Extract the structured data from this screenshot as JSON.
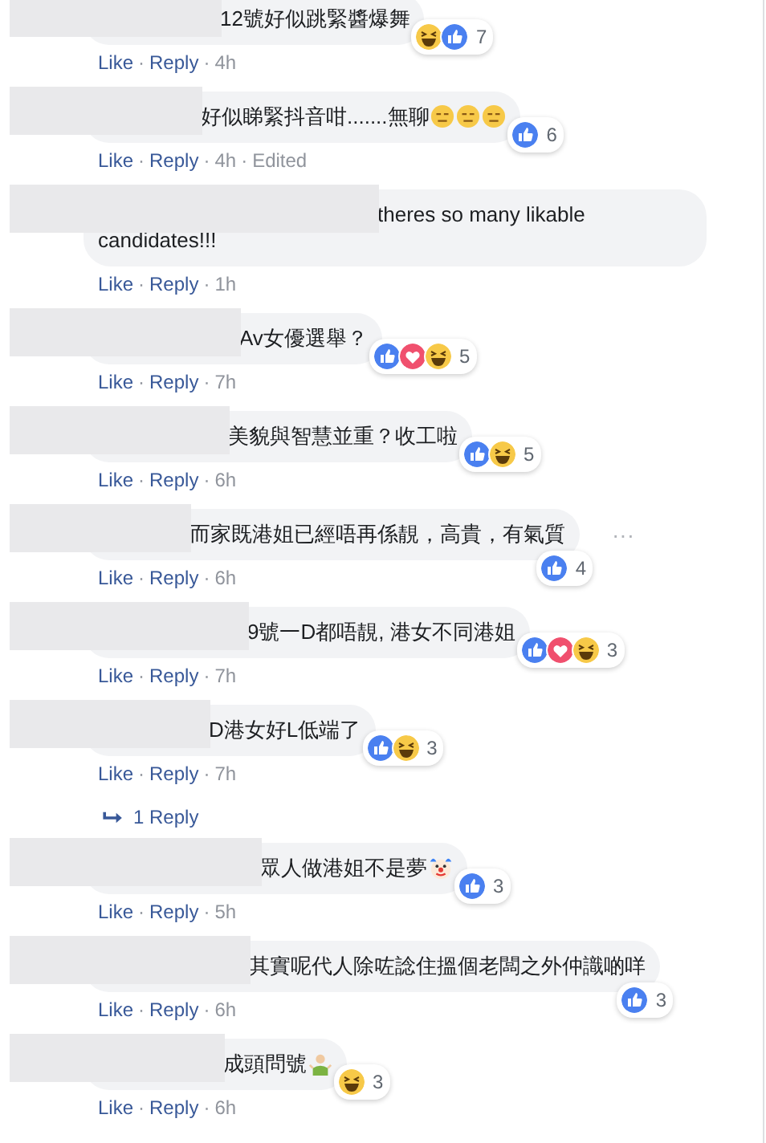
{
  "comments": [
    {
      "name_hidden": true,
      "text": "12號好似跳緊醬爆舞",
      "reactions": [
        {
          "kind": "haha"
        },
        {
          "kind": "like"
        }
      ],
      "reaction_count": "7",
      "meta": [
        {
          "kind": "link",
          "text": "Like"
        },
        {
          "kind": "dot",
          "text": "·"
        },
        {
          "kind": "link",
          "text": "Reply"
        },
        {
          "kind": "dot",
          "text": "·"
        },
        {
          "kind": "time",
          "text": "4h"
        }
      ]
    },
    {
      "name_hidden": true,
      "text": "好似睇緊抖音咁.......無聊",
      "emoji": [
        {
          "kind": "expressionless"
        },
        {
          "kind": "expressionless"
        },
        {
          "kind": "expressionless"
        }
      ],
      "reactions": [
        {
          "kind": "like"
        }
      ],
      "reaction_count": "6",
      "meta": [
        {
          "kind": "link",
          "text": "Like"
        },
        {
          "kind": "dot",
          "text": "·"
        },
        {
          "kind": "link",
          "text": "Reply"
        },
        {
          "kind": "dot",
          "text": "·"
        },
        {
          "kind": "time",
          "text": "4h"
        },
        {
          "kind": "dot",
          "text": "·"
        },
        {
          "kind": "note",
          "text": "Edited"
        }
      ]
    },
    {
      "name_hidden": true,
      "text": "theres so many likable candidates!!!",
      "meta": [
        {
          "kind": "link",
          "text": "Like"
        },
        {
          "kind": "dot",
          "text": "·"
        },
        {
          "kind": "link",
          "text": "Reply"
        },
        {
          "kind": "dot",
          "text": "·"
        },
        {
          "kind": "time",
          "text": "1h"
        }
      ]
    },
    {
      "name_hidden": true,
      "text": "Av女優選舉？",
      "reactions": [
        {
          "kind": "like"
        },
        {
          "kind": "love"
        },
        {
          "kind": "haha"
        }
      ],
      "reaction_count": "5",
      "meta": [
        {
          "kind": "link",
          "text": "Like"
        },
        {
          "kind": "dot",
          "text": "·"
        },
        {
          "kind": "link",
          "text": "Reply"
        },
        {
          "kind": "dot",
          "text": "·"
        },
        {
          "kind": "time",
          "text": "7h"
        }
      ]
    },
    {
      "name_hidden": true,
      "text": "美貌與智慧並重？收工啦",
      "reactions": [
        {
          "kind": "like"
        },
        {
          "kind": "haha"
        }
      ],
      "reaction_count": "5",
      "meta": [
        {
          "kind": "link",
          "text": "Like"
        },
        {
          "kind": "dot",
          "text": "·"
        },
        {
          "kind": "link",
          "text": "Reply"
        },
        {
          "kind": "dot",
          "text": "·"
        },
        {
          "kind": "time",
          "text": "6h"
        }
      ]
    },
    {
      "name_hidden": true,
      "text": "而家既港姐已經唔再係靚，高貴，有氣質",
      "reactions": [
        {
          "kind": "like"
        }
      ],
      "reaction_count": "4",
      "menu": "···",
      "meta": [
        {
          "kind": "link",
          "text": "Like"
        },
        {
          "kind": "dot",
          "text": "·"
        },
        {
          "kind": "link",
          "text": "Reply"
        },
        {
          "kind": "dot",
          "text": "·"
        },
        {
          "kind": "time",
          "text": "6h"
        }
      ]
    },
    {
      "name_hidden": true,
      "text": "9號一D都唔靚, 港女不同港姐",
      "reactions": [
        {
          "kind": "like"
        },
        {
          "kind": "love"
        },
        {
          "kind": "haha"
        }
      ],
      "reaction_count": "3",
      "meta": [
        {
          "kind": "link",
          "text": "Like"
        },
        {
          "kind": "dot",
          "text": "·"
        },
        {
          "kind": "link",
          "text": "Reply"
        },
        {
          "kind": "dot",
          "text": "·"
        },
        {
          "kind": "time",
          "text": "7h"
        }
      ]
    },
    {
      "name_hidden": true,
      "text": "D港女好L低端了",
      "reactions": [
        {
          "kind": "like"
        },
        {
          "kind": "haha"
        }
      ],
      "reaction_count": "3",
      "replies": "1 Reply",
      "meta": [
        {
          "kind": "link",
          "text": "Like"
        },
        {
          "kind": "dot",
          "text": "·"
        },
        {
          "kind": "link",
          "text": "Reply"
        },
        {
          "kind": "dot",
          "text": "·"
        },
        {
          "kind": "time",
          "text": "7h"
        }
      ]
    },
    {
      "name_hidden": true,
      "text": "眾人做港姐不是夢",
      "emoji": [
        {
          "kind": "clown"
        }
      ],
      "reactions": [
        {
          "kind": "like"
        }
      ],
      "reaction_count": "3",
      "meta": [
        {
          "kind": "link",
          "text": "Like"
        },
        {
          "kind": "dot",
          "text": "·"
        },
        {
          "kind": "link",
          "text": "Reply"
        },
        {
          "kind": "dot",
          "text": "·"
        },
        {
          "kind": "time",
          "text": "5h"
        }
      ]
    },
    {
      "name_hidden": true,
      "text": "其實呢代人除咗諗住搵個老闆之外仲識啲咩",
      "reactions": [
        {
          "kind": "like"
        }
      ],
      "reaction_count": "3",
      "meta": [
        {
          "kind": "link",
          "text": "Like"
        },
        {
          "kind": "dot",
          "text": "·"
        },
        {
          "kind": "link",
          "text": "Reply"
        },
        {
          "kind": "dot",
          "text": "·"
        },
        {
          "kind": "time",
          "text": "6h"
        }
      ]
    },
    {
      "name_hidden": true,
      "text": "成頭問號",
      "emoji": [
        {
          "kind": "shrug"
        }
      ],
      "reactions": [
        {
          "kind": "haha"
        }
      ],
      "reaction_count": "3",
      "meta": [
        {
          "kind": "link",
          "text": "Like"
        },
        {
          "kind": "dot",
          "text": "·"
        },
        {
          "kind": "link",
          "text": "Reply"
        },
        {
          "kind": "dot",
          "text": "·"
        },
        {
          "kind": "time",
          "text": "6h"
        }
      ]
    }
  ]
}
